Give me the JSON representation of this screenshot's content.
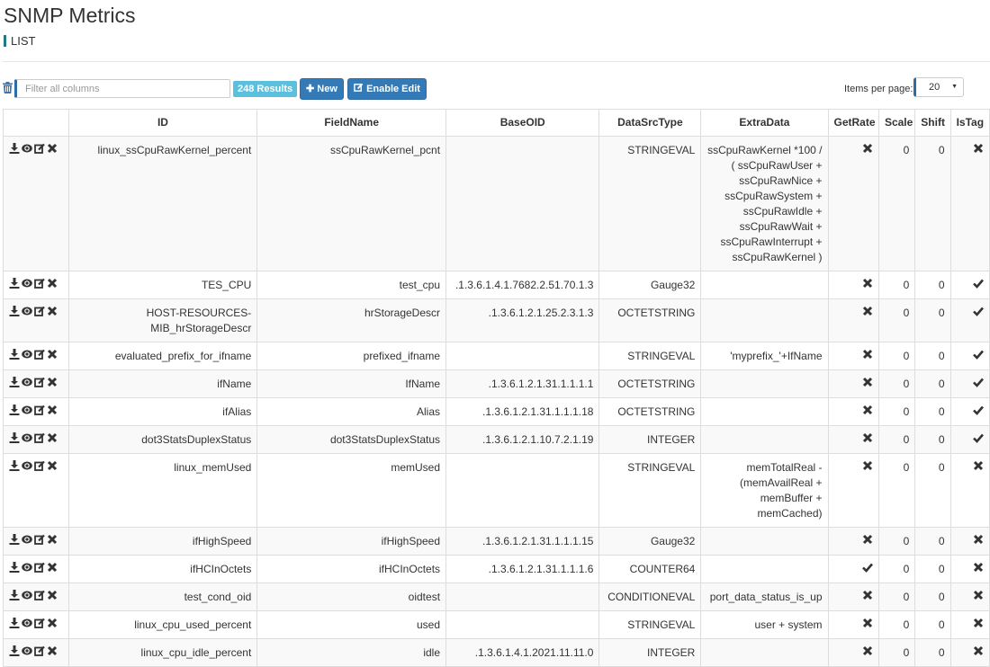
{
  "header": {
    "title": "SNMP Metrics",
    "subtitle": "LIST"
  },
  "toolbar": {
    "filter_placeholder": "Filter all columns",
    "filter_value": "",
    "results_badge": "248 Results",
    "new_label": "New",
    "enable_edit_label": "Enable Edit",
    "items_per_page_label": "Items per page:",
    "items_per_page_value": "20"
  },
  "colors": {
    "primary": "#337ab7",
    "info": "#5bc0de",
    "accent": "#1f7a86"
  },
  "table": {
    "columns": [
      "",
      "ID",
      "FieldName",
      "BaseOID",
      "DataSrcType",
      "ExtraData",
      "GetRate",
      "Scale",
      "Shift",
      "IsTag"
    ],
    "row_actions": [
      "download-icon",
      "eye-icon",
      "edit-icon",
      "delete-icon"
    ],
    "rows": [
      {
        "id": "linux_ssCpuRawKernel_percent",
        "fieldname": "ssCpuRawKernel_pcnt",
        "baseoid": "",
        "datasrctype": "STRINGEVAL",
        "extradata": "ssCpuRawKernel *100 / ( ssCpuRawUser + ssCpuRawNice + ssCpuRawSystem + ssCpuRawIdle + ssCpuRawWait + ssCpuRawInterrupt + ssCpuRawKernel )",
        "getrate": false,
        "scale": "0",
        "shift": "0",
        "istag": false
      },
      {
        "id": "TES_CPU",
        "fieldname": "test_cpu",
        "baseoid": ".1.3.6.1.4.1.7682.2.51.70.1.3",
        "datasrctype": "Gauge32",
        "extradata": "",
        "getrate": false,
        "scale": "0",
        "shift": "0",
        "istag": true
      },
      {
        "id": "HOST-RESOURCES-MIB_hrStorageDescr",
        "fieldname": "hrStorageDescr",
        "baseoid": ".1.3.6.1.2.1.25.2.3.1.3",
        "datasrctype": "OCTETSTRING",
        "extradata": "",
        "getrate": false,
        "scale": "0",
        "shift": "0",
        "istag": true
      },
      {
        "id": "evaluated_prefix_for_ifname",
        "fieldname": "prefixed_ifname",
        "baseoid": "",
        "datasrctype": "STRINGEVAL",
        "extradata": "'myprefix_'+IfName",
        "getrate": false,
        "scale": "0",
        "shift": "0",
        "istag": true
      },
      {
        "id": "ifName",
        "fieldname": "IfName",
        "baseoid": ".1.3.6.1.2.1.31.1.1.1.1",
        "datasrctype": "OCTETSTRING",
        "extradata": "",
        "getrate": false,
        "scale": "0",
        "shift": "0",
        "istag": true
      },
      {
        "id": "ifAlias",
        "fieldname": "Alias",
        "baseoid": ".1.3.6.1.2.1.31.1.1.1.18",
        "datasrctype": "OCTETSTRING",
        "extradata": "",
        "getrate": false,
        "scale": "0",
        "shift": "0",
        "istag": true
      },
      {
        "id": "dot3StatsDuplexStatus",
        "fieldname": "dot3StatsDuplexStatus",
        "baseoid": ".1.3.6.1.2.1.10.7.2.1.19",
        "datasrctype": "INTEGER",
        "extradata": "",
        "getrate": false,
        "scale": "0",
        "shift": "0",
        "istag": true
      },
      {
        "id": "linux_memUsed",
        "fieldname": "memUsed",
        "baseoid": "",
        "datasrctype": "STRINGEVAL",
        "extradata": "memTotalReal - (memAvailReal + memBuffer + memCached)",
        "getrate": false,
        "scale": "0",
        "shift": "0",
        "istag": false
      },
      {
        "id": "ifHighSpeed",
        "fieldname": "ifHighSpeed",
        "baseoid": ".1.3.6.1.2.1.31.1.1.1.15",
        "datasrctype": "Gauge32",
        "extradata": "",
        "getrate": false,
        "scale": "0",
        "shift": "0",
        "istag": false
      },
      {
        "id": "ifHCInOctets",
        "fieldname": "ifHCInOctets",
        "baseoid": ".1.3.6.1.2.1.31.1.1.1.6",
        "datasrctype": "COUNTER64",
        "extradata": "",
        "getrate": true,
        "scale": "0",
        "shift": "0",
        "istag": false
      },
      {
        "id": "test_cond_oid",
        "fieldname": "oidtest",
        "baseoid": "",
        "datasrctype": "CONDITIONEVAL",
        "extradata": "port_data_status_is_up",
        "getrate": false,
        "scale": "0",
        "shift": "0",
        "istag": false
      },
      {
        "id": "linux_cpu_used_percent",
        "fieldname": "used",
        "baseoid": "",
        "datasrctype": "STRINGEVAL",
        "extradata": "user + system",
        "getrate": false,
        "scale": "0",
        "shift": "0",
        "istag": false
      },
      {
        "id": "linux_cpu_idle_percent",
        "fieldname": "idle",
        "baseoid": ".1.3.6.1.4.1.2021.11.11.0",
        "datasrctype": "INTEGER",
        "extradata": "",
        "getrate": false,
        "scale": "0",
        "shift": "0",
        "istag": false
      }
    ]
  }
}
